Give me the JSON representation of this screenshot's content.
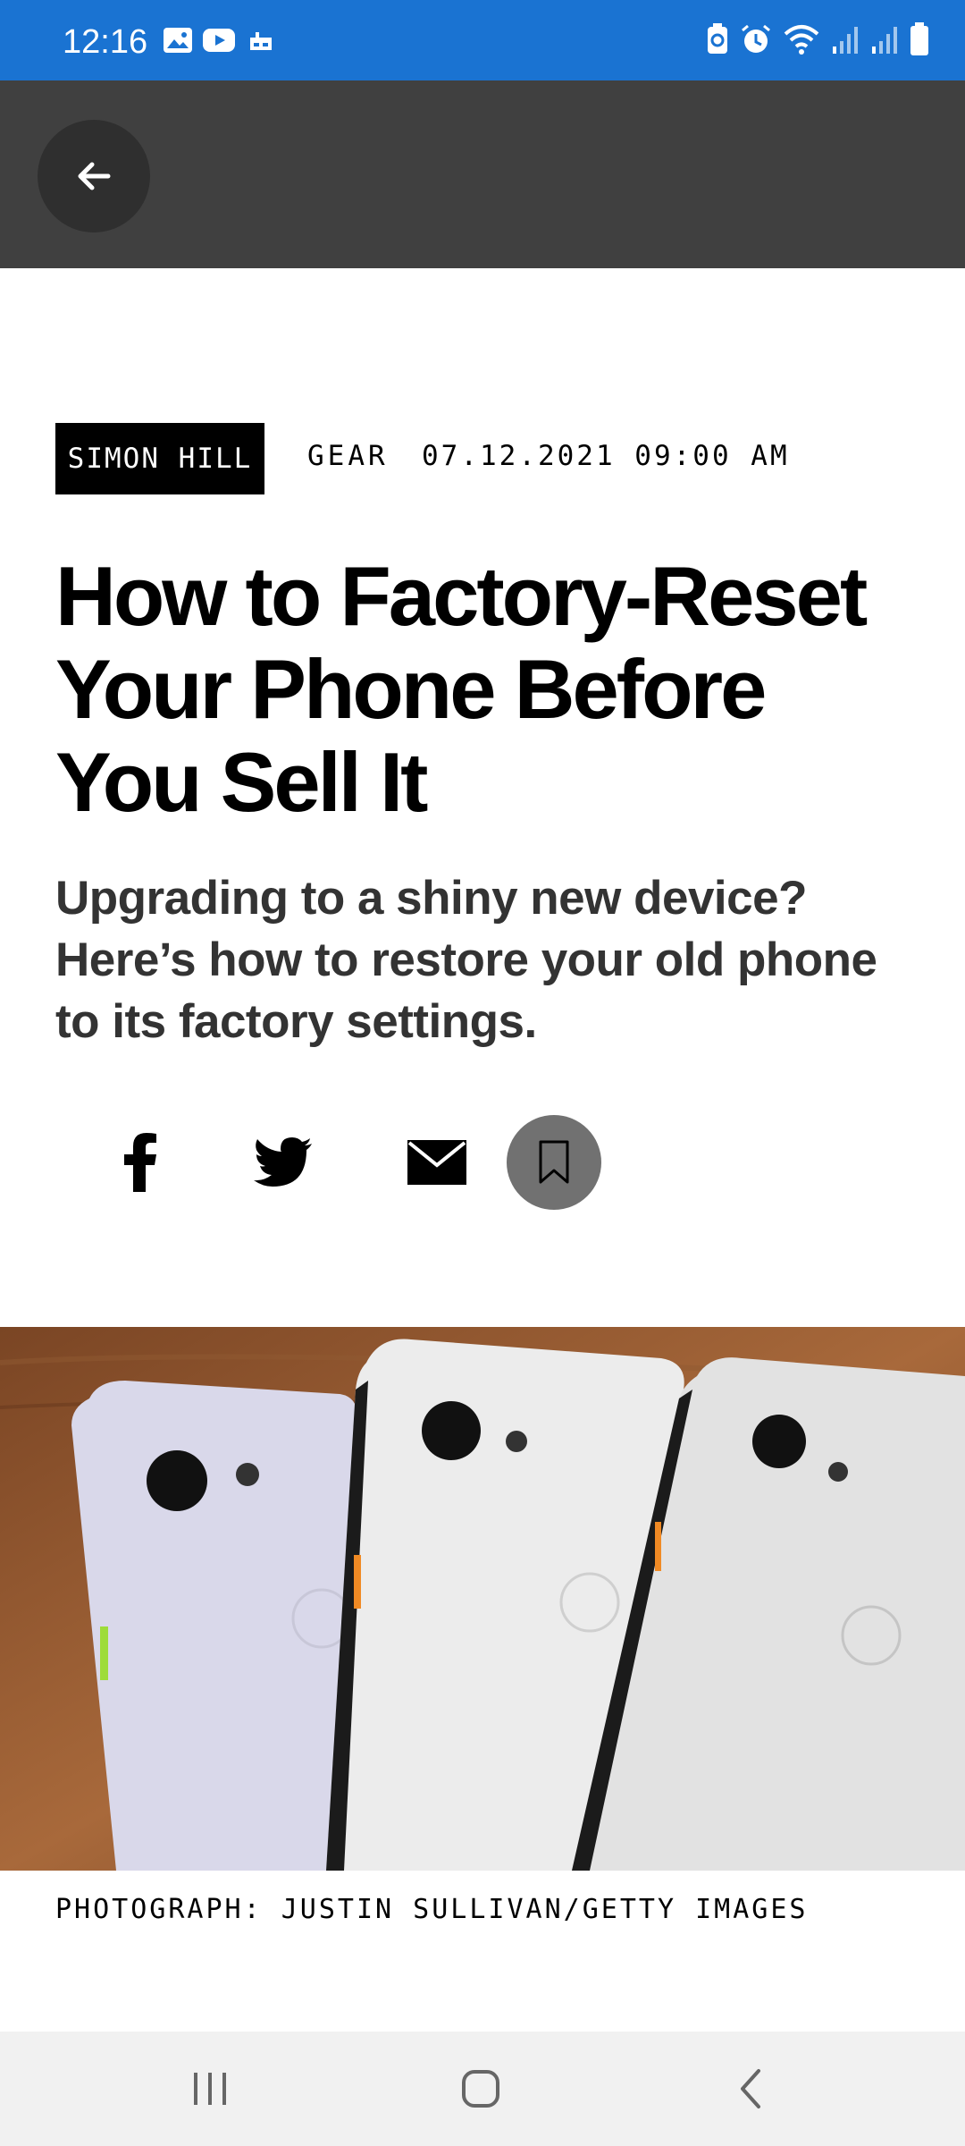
{
  "status_bar": {
    "time": "12:16",
    "left_icons": [
      "gallery-icon",
      "youtube-icon",
      "app-notification-icon"
    ],
    "right_icons": [
      "battery-saver-icon",
      "alarm-icon",
      "wifi-icon",
      "signal-icon",
      "signal-icon",
      "battery-icon"
    ],
    "background": "#1a73d2"
  },
  "app_bar": {
    "back_icon": "arrow-left-icon",
    "background": "#404040"
  },
  "article": {
    "author": "SIMON HILL",
    "category": "GEAR",
    "date": "07.12.2021 09:00 AM",
    "headline": "How to Factory-Reset Your Phone Before You Sell It",
    "subhead": "Upgrading to a shiny new device? Here’s how to restore your old phone to its factory settings.",
    "share_icons": [
      "facebook-icon",
      "twitter-icon",
      "email-icon",
      "bookmark-icon"
    ],
    "image_caption": "PHOTOGRAPH: JUSTIN SULLIVAN/GETTY IMAGES"
  },
  "nav_bar": {
    "icons": [
      "recent-apps-icon",
      "home-icon",
      "back-icon"
    ]
  }
}
